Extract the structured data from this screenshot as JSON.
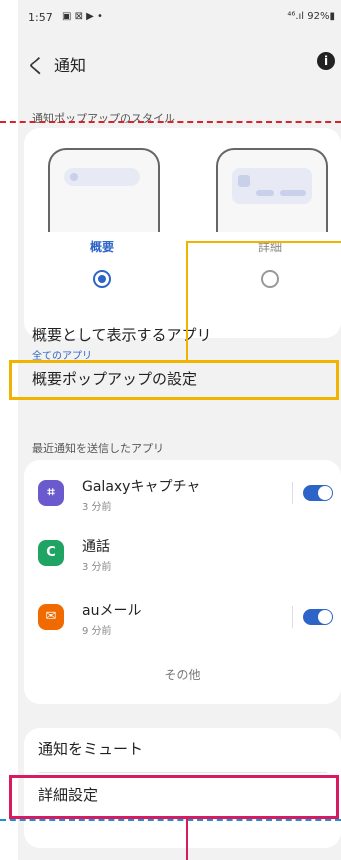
{
  "status_bar": {
    "time": "1:57",
    "icons": "▣ ⊠ ▶ •",
    "right": "⁴⁶.ıl 92%▮"
  },
  "header": {
    "back": "く",
    "title": "通知",
    "info_icon": "i"
  },
  "popup_style": {
    "section_label": "通知ポップアップのスタイル",
    "options": [
      {
        "label": "概要",
        "selected": true
      },
      {
        "label": "詳細",
        "selected": false
      }
    ],
    "brief_apps_title": "概要として表示するアプリ",
    "brief_apps_value": "全てのアプリ",
    "brief_popup_settings": "概要ポップアップの設定"
  },
  "recent_apps": {
    "section_label": "最近通知を送信したアプリ",
    "items": [
      {
        "name": "Galaxyキャプチャ",
        "time": "3 分前",
        "icon": "capture-icon",
        "icon_color": "#6a5acd",
        "toggle": true
      },
      {
        "name": "通話",
        "time": "3 分前",
        "icon": "phone-icon",
        "icon_color": "#1fa463",
        "toggle": false
      },
      {
        "name": "auメール",
        "time": "9 分前",
        "icon": "au-mail-icon",
        "icon_color": "#f06a00",
        "toggle": true
      }
    ],
    "more": "その他"
  },
  "bottom": {
    "mute": "通知をミュート",
    "advanced": "詳細設定"
  },
  "colors": {
    "accent": "#2d64c8",
    "annot_red": "#d0262c",
    "annot_yellow": "#f0b400",
    "annot_blue": "#1e8fd0",
    "annot_magenta": "#d81b60"
  }
}
